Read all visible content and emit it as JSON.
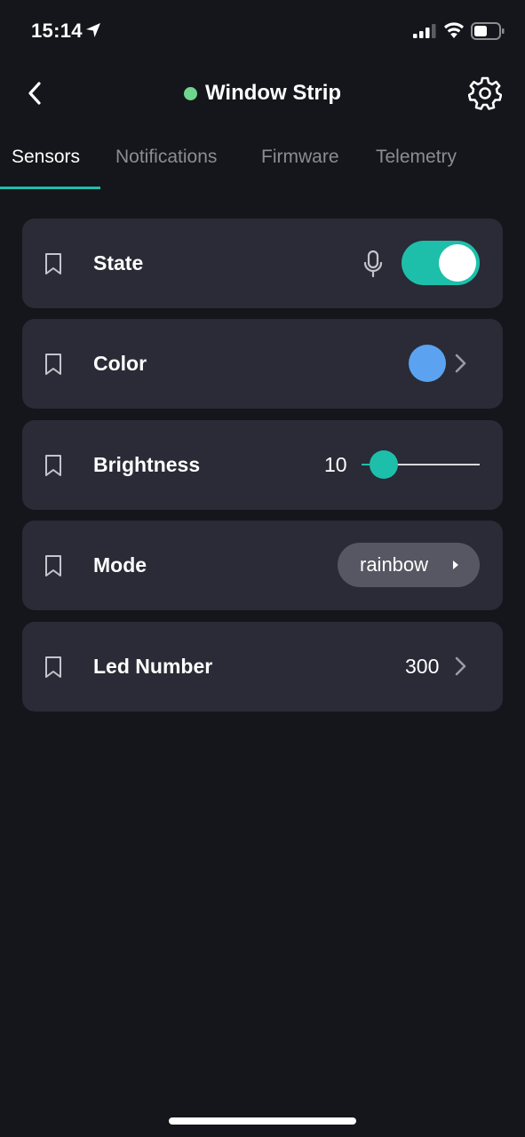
{
  "status_bar": {
    "time": "15:14"
  },
  "header": {
    "title": "Window Strip",
    "online_color": "#6fd58d"
  },
  "tabs": [
    {
      "label": "Sensors",
      "active": true
    },
    {
      "label": "Notifications",
      "active": false
    },
    {
      "label": "Firmware",
      "active": false
    },
    {
      "label": "Telemetry",
      "active": false
    }
  ],
  "accent_color": "#1dbfab",
  "sensors": {
    "state": {
      "label": "State",
      "on": true
    },
    "color": {
      "label": "Color",
      "value": "#5ba3f0"
    },
    "brightness": {
      "label": "Brightness",
      "value": "10",
      "fraction": 0.19
    },
    "mode": {
      "label": "Mode",
      "value": "rainbow"
    },
    "led_number": {
      "label": "Led Number",
      "value": "300"
    }
  }
}
